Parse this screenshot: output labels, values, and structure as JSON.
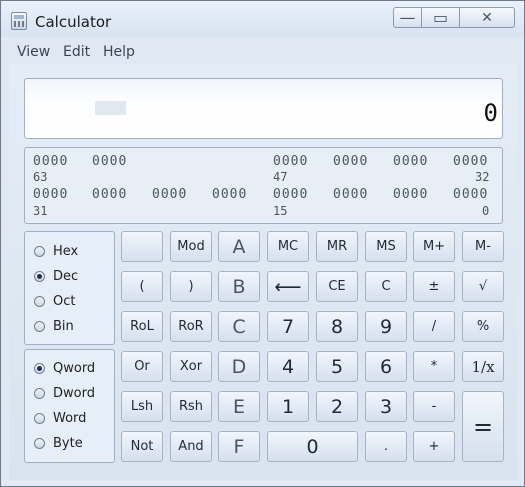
{
  "window": {
    "title": "Calculator"
  },
  "titlebar": {
    "min_glyph": "—",
    "max_glyph": "▭",
    "close_glyph": "✕"
  },
  "menu": [
    "View",
    "Edit",
    "Help"
  ],
  "display": {
    "value": "0"
  },
  "bits": {
    "top_row": [
      "0000",
      "0000",
      "0000",
      "0000",
      "0000",
      "0000"
    ],
    "top_labels": {
      "left": "63",
      "mid": "47",
      "right": "32"
    },
    "bottom_row": [
      "0000",
      "0000",
      "0000",
      "0000",
      "0000",
      "0000",
      "0000",
      "0000"
    ],
    "bottom_labels": {
      "left": "31",
      "mid": "15",
      "right": "0"
    }
  },
  "base": {
    "options": [
      "Hex",
      "Dec",
      "Oct",
      "Bin"
    ],
    "selected": "Dec"
  },
  "wordsize": {
    "options": [
      "Qword",
      "Dword",
      "Word",
      "Byte"
    ],
    "selected": "Qword"
  },
  "keys": {
    "blank": "",
    "mod": "Mod",
    "a": "A",
    "mc": "MC",
    "mr": "MR",
    "ms": "MS",
    "mplus": "M+",
    "mminus": "M-",
    "lparen": "(",
    "rparen": ")",
    "b": "B",
    "back": "⟵",
    "ce": "CE",
    "c": "C",
    "plusminus": "±",
    "sqrt": "√",
    "rol": "RoL",
    "ror": "RoR",
    "c_hex": "C",
    "seven": "7",
    "eight": "8",
    "nine": "9",
    "div": "/",
    "pct": "%",
    "or": "Or",
    "xor": "Xor",
    "d": "D",
    "four": "4",
    "five": "5",
    "six": "6",
    "mul": "*",
    "recip": "1/x",
    "lsh": "Lsh",
    "rsh": "Rsh",
    "e": "E",
    "one": "1",
    "two": "2",
    "three": "3",
    "minus": "-",
    "equals": "=",
    "not": "Not",
    "and": "And",
    "f": "F",
    "zero": "0",
    "dot": ".",
    "plus": "+"
  }
}
